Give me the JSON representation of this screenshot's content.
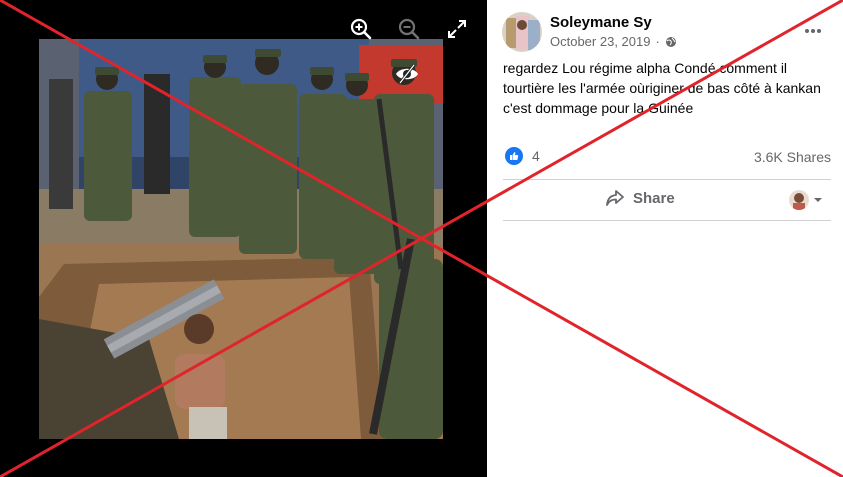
{
  "viewer": {
    "zoom_in_icon": "magnifier-plus-icon",
    "zoom_out_icon": "magnifier-minus-icon",
    "fullscreen_icon": "expand-arrows-icon",
    "eye_icon": "eye-slash-icon"
  },
  "post": {
    "author": "Soleymane Sy",
    "date": "October 23, 2019",
    "separator": "·",
    "audience_icon": "globe-icon",
    "more_icon": "ellipsis-icon",
    "text": "regardez Lou régime alpha Condé comment il tourtière les l'armée oùriginer de bas côté à kankan c'est dommage pour la Guinée",
    "reaction_icon": "thumbs-up-icon",
    "reaction_count": "4",
    "shares": "3.6K Shares",
    "share_label": "Share",
    "share_icon": "share-arrow-icon"
  },
  "overlay": {
    "mark": "red-cross",
    "color": "#e0242b"
  }
}
